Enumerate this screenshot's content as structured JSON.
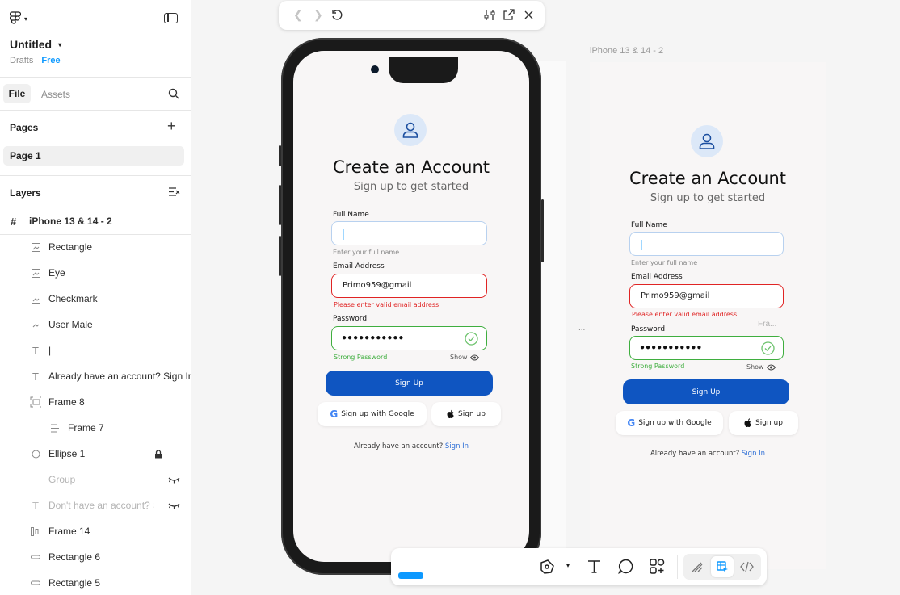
{
  "sidebar": {
    "file_name": "Untitled",
    "drafts": "Drafts",
    "plan": "Free",
    "tabs": [
      "File",
      "Assets"
    ],
    "pages_title": "Pages",
    "page_item": "Page 1",
    "layers_title": "Layers",
    "frame_root": "iPhone 13 & 14 - 2",
    "layers": [
      {
        "label": "Rectangle",
        "icon": "image-icon"
      },
      {
        "label": "Eye",
        "icon": "image-icon"
      },
      {
        "label": "Checkmark",
        "icon": "image-icon"
      },
      {
        "label": "User Male",
        "icon": "image-icon"
      },
      {
        "label": "|",
        "icon": "text-icon"
      },
      {
        "label": "Already have an account? Sign In",
        "icon": "text-icon"
      },
      {
        "label": "Frame 8",
        "icon": "frame-icon"
      },
      {
        "label": "Frame 7",
        "icon": "autolayout-icon"
      },
      {
        "label": "Ellipse 1",
        "icon": "ellipse-icon"
      },
      {
        "label": "Group",
        "icon": "group-icon"
      },
      {
        "label": "Don't have an account? S",
        "icon": "text-icon"
      },
      {
        "label": "Frame 14",
        "icon": "autolayout-icon"
      },
      {
        "label": "Rectangle 6",
        "icon": "line-icon"
      },
      {
        "label": "Rectangle 5",
        "icon": "line-icon"
      }
    ]
  },
  "canvas": {
    "frame_label": "iPhone 13 & 14 - 2",
    "ellipsis": "...",
    "fra_label": "Fra..."
  },
  "form": {
    "title": "Create an Account",
    "subtitle": "Sign up to get started",
    "fullname_label": "Full Name",
    "fullname_value": "|",
    "fullname_hint": "Enter your full name",
    "email_label": "Email Address",
    "email_value": "Primo959@gmail",
    "email_error": "Please enter valid email address",
    "password_label": "Password",
    "password_value": "●●●●●●●●●●●",
    "password_strength": "Strong Password",
    "show_label": "Show",
    "signup_button": "Sign Up",
    "google_button": "Sign up with Google",
    "apple_button": "Sign up",
    "footer_text": "Already have an account?",
    "footer_link": "Sign In"
  },
  "colors": {
    "primary": "#0f55c1",
    "error": "#e02424",
    "success": "#3fae3f",
    "link": "#2f6fd6",
    "figma_blue": "#0d99ff"
  }
}
